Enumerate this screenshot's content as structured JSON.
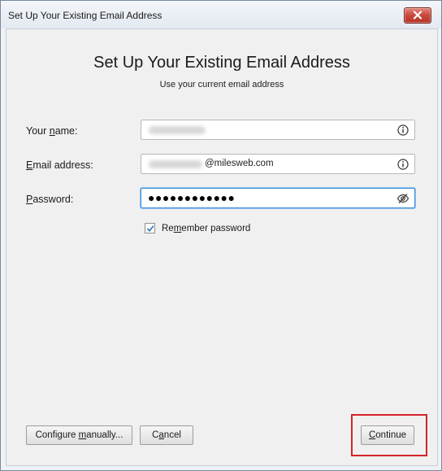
{
  "window": {
    "title": "Set Up Your Existing Email Address"
  },
  "dialog": {
    "heading": "Set Up Your Existing Email Address",
    "subheading": "Use your current email address"
  },
  "form": {
    "name": {
      "label_prefix": "Your ",
      "label_accel": "n",
      "label_suffix": "ame:",
      "value": ""
    },
    "email": {
      "label_prefix": "",
      "label_accel": "E",
      "label_suffix": "mail address:",
      "value_domain": "@milesweb.com"
    },
    "password": {
      "label_prefix": "",
      "label_accel": "P",
      "label_suffix": "assword:",
      "masked_value": "●●●●●●●●●●●●"
    },
    "remember": {
      "checked": true,
      "label_prefix": "Re",
      "label_accel": "m",
      "label_suffix": "ember password"
    }
  },
  "buttons": {
    "configure_prefix": "Configure ",
    "configure_accel": "m",
    "configure_suffix": "anually...",
    "cancel_prefix": "C",
    "cancel_accel": "a",
    "cancel_suffix": "ncel",
    "continue_prefix": "",
    "continue_accel": "C",
    "continue_suffix": "ontinue"
  },
  "icons": {
    "close": "close-icon",
    "info": "info-icon",
    "eye": "eye-slash-icon",
    "check": "checkmark-icon"
  },
  "colors": {
    "close_button": "#c9463a",
    "focus_border": "#3a8ddb",
    "highlight_box": "#d4232b",
    "checkmark": "#2a6fb8"
  }
}
